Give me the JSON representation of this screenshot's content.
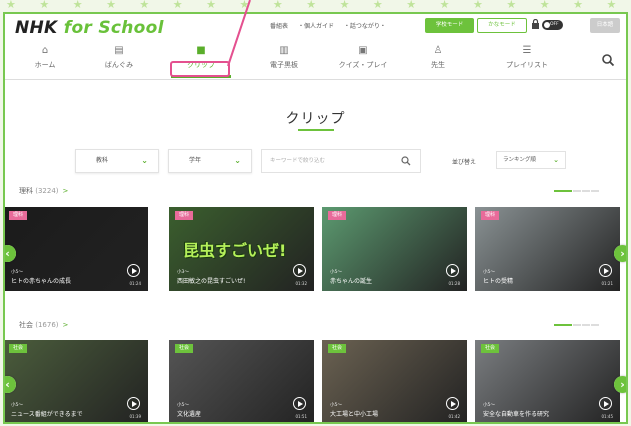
{
  "stars": "★ ★ ★ ★ ★ ★ ★ ★ ★ ★ ★ ★ ★ ★ ★ ★ ★ ★ ★ ★ ★ ★ ★ ★ ★ ★ ★ ★",
  "header": {
    "logo_main": "NHK ",
    "logo_accent": "for School",
    "links": [
      "番組表",
      "・個人ガイド",
      "・話つながり・"
    ],
    "btn_student": "学校モード",
    "btn_mode": "かなモード",
    "toggle": "OFF",
    "lang": "日本語"
  },
  "nav": [
    {
      "icon": "home-icon",
      "glyph": "⌂",
      "label": "ホーム"
    },
    {
      "icon": "tv-icon",
      "glyph": "▤",
      "label": "ばんぐみ"
    },
    {
      "icon": "clip-icon",
      "glyph": "■",
      "label": "クリップ"
    },
    {
      "icon": "ebook-icon",
      "glyph": "▥",
      "label": "電子黒板"
    },
    {
      "icon": "quiz-icon",
      "glyph": "▣",
      "label": "クイズ・プレイ"
    },
    {
      "icon": "teacher-icon",
      "glyph": "♙",
      "label": "先生"
    },
    {
      "icon": "playlist-icon",
      "glyph": "☰",
      "label": "プレイリスト"
    }
  ],
  "page_title": "クリップ",
  "filters": {
    "subject": "教科",
    "grade": "学年",
    "keyword_placeholder": "キーワードで絞り込む",
    "sort_label": "並び替え",
    "sort_value": "ランキング順"
  },
  "sections": [
    {
      "title": "理科",
      "count": "(3224)",
      "arrow": ">",
      "cards": [
        {
          "tag": "理科",
          "grade": "小5〜",
          "title": "ヒトの赤ちゃんの成長",
          "dur": "01:24",
          "bg": "#1b1b1b",
          "overlay": "",
          "tagcolor": "#e86b9a"
        },
        {
          "tag": "理科",
          "grade": "小3〜",
          "title": "西田敏之の昆虫すごいぜ!",
          "dur": "01:32",
          "bg": "#3b5f2e",
          "overlay": "昆虫すごいぜ!",
          "tagcolor": "#e86b9a"
        },
        {
          "tag": "理科",
          "grade": "小5〜",
          "title": "赤ちゃんの誕生",
          "dur": "01:28",
          "bg": "#5c9a70",
          "overlay": "",
          "tagcolor": "#e86b9a"
        },
        {
          "tag": "理科",
          "grade": "小5〜",
          "title": "ヒトの受精",
          "dur": "01:21",
          "bg": "#8a9294",
          "overlay": "",
          "tagcolor": "#e86b9a"
        }
      ]
    },
    {
      "title": "社会",
      "count": "(1676)",
      "arrow": ">",
      "cards": [
        {
          "tag": "社会",
          "grade": "小5〜",
          "title": "ニュース番組ができるまで",
          "dur": "01:39",
          "bg": "#4b5d3c",
          "overlay": "",
          "tagcolor": "#6dc23c"
        },
        {
          "tag": "社会",
          "grade": "小5〜",
          "title": "文化遺産",
          "dur": "01:51",
          "bg": "#555555",
          "overlay": "",
          "tagcolor": "#6dc23c"
        },
        {
          "tag": "社会",
          "grade": "小5〜",
          "title": "大工場と中小工場",
          "dur": "01:42",
          "bg": "#6b6252",
          "overlay": "",
          "tagcolor": "#6dc23c"
        },
        {
          "tag": "社会",
          "grade": "小5〜",
          "title": "安全な自動車を作る研究",
          "dur": "01:45",
          "bg": "#7a7d80",
          "overlay": "",
          "tagcolor": "#6dc23c"
        }
      ]
    }
  ],
  "colors": {
    "accent": "#6dc23c",
    "callout": "#e4508f"
  }
}
